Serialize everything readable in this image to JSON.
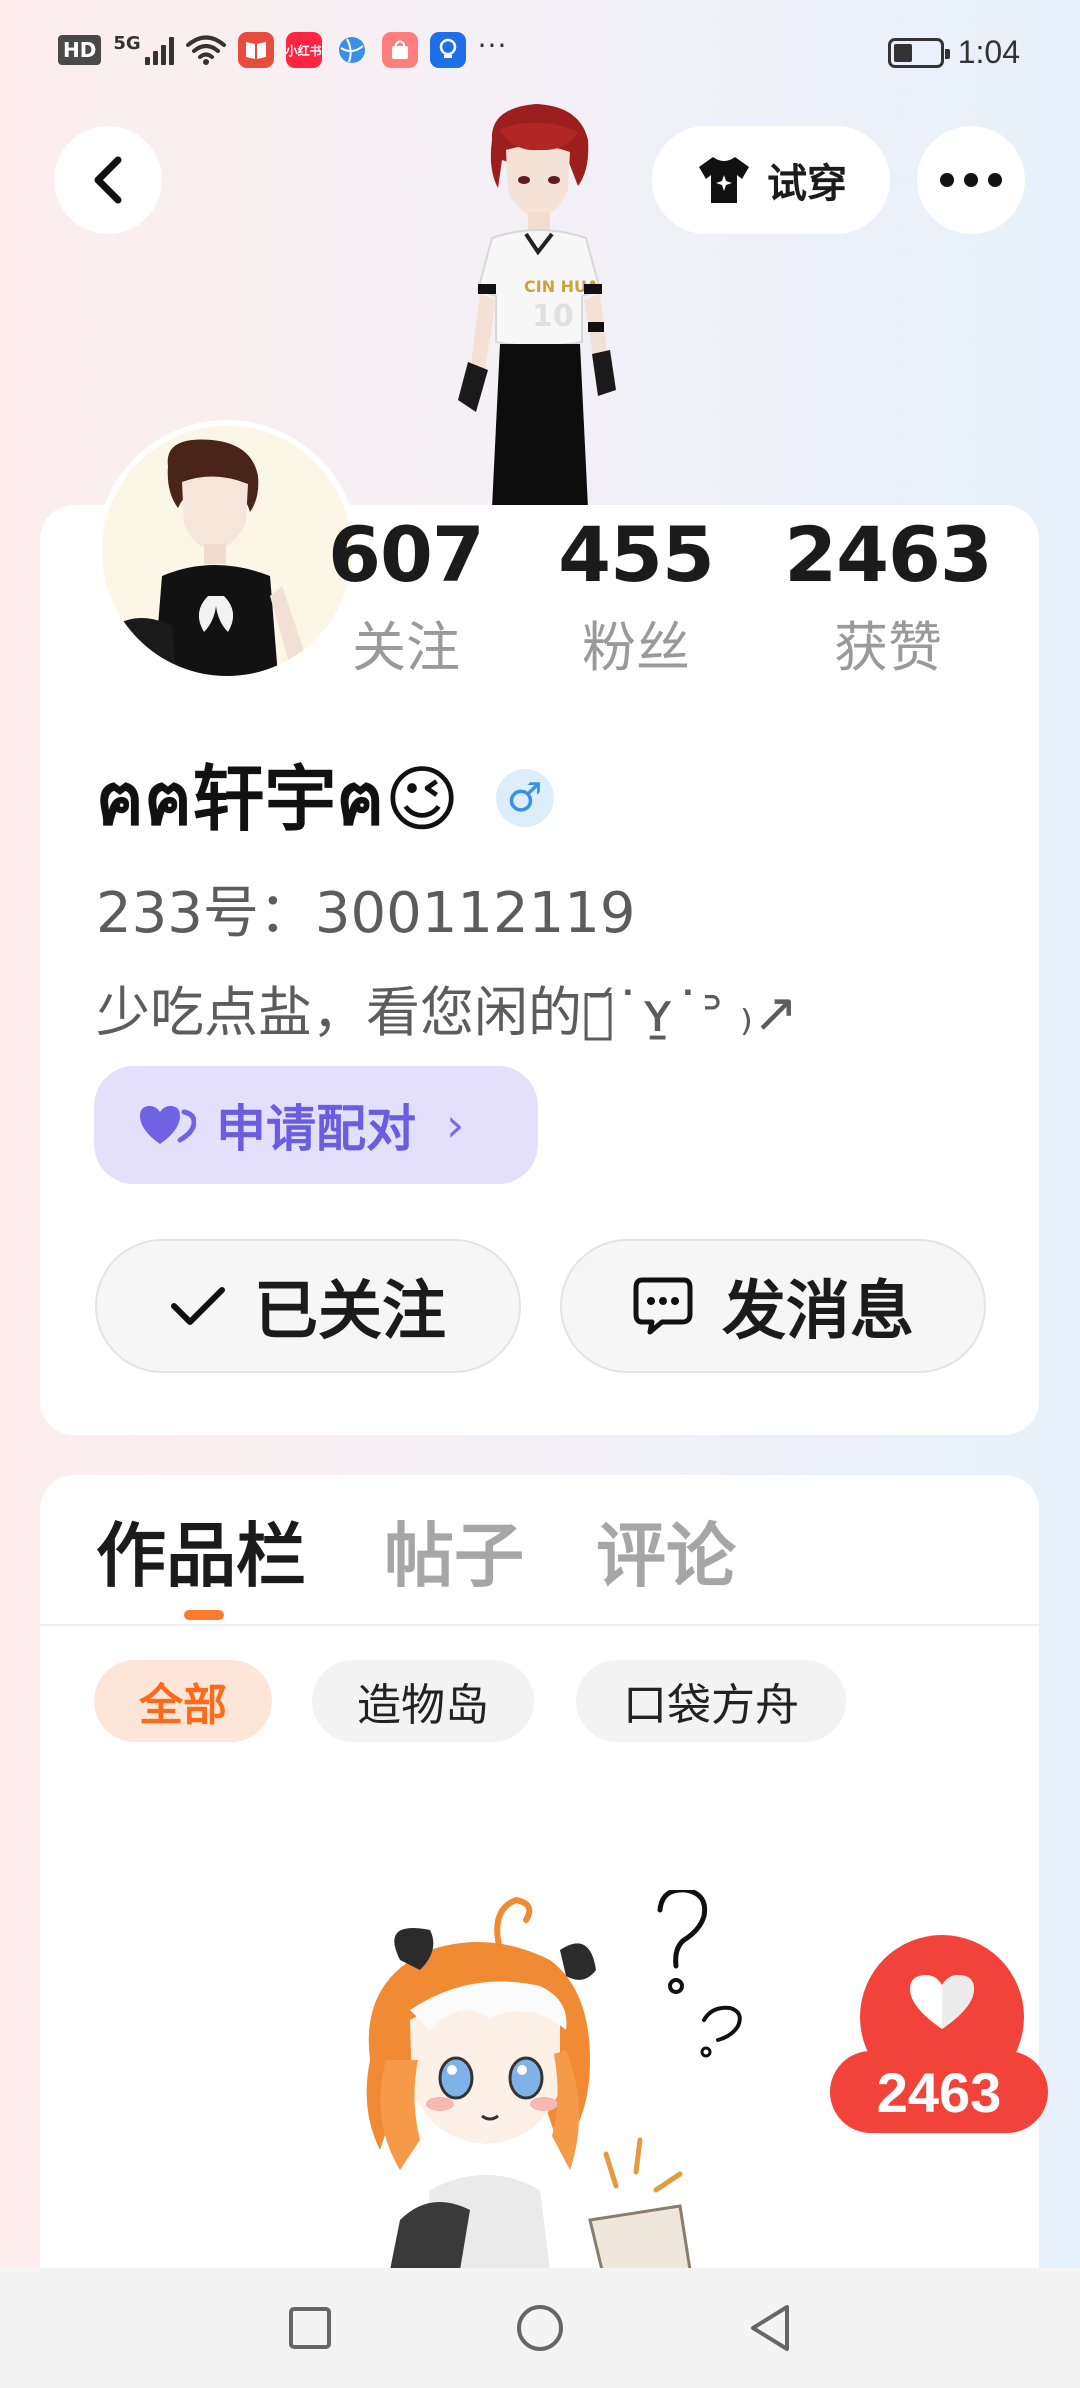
{
  "status_bar": {
    "hd_label": "HD",
    "network": "5G",
    "app_icons": [
      {
        "name": "red-book-icon",
        "color": "#e84c3d",
        "label": ""
      },
      {
        "name": "xiaohongshu-icon",
        "color": "#ff2442",
        "label": "小红书"
      },
      {
        "name": "globe-icon",
        "color": "#3a8fe6",
        "label": ""
      },
      {
        "name": "shopping-icon",
        "color": "#ff6b6b",
        "label": ""
      },
      {
        "name": "lightbulb-icon",
        "color": "#1e6fe8",
        "label": ""
      }
    ],
    "more": "···",
    "time": "1:04",
    "battery_level": 0.42
  },
  "header": {
    "tryon_label": "试穿"
  },
  "profile": {
    "stats": [
      {
        "value": "607",
        "label": "关注"
      },
      {
        "value": "455",
        "label": "粉丝"
      },
      {
        "value": "2463",
        "label": "获赞"
      }
    ],
    "username": "ฅฅ轩宇ฅ😉",
    "gender_symbol": "♂",
    "uid": "233号：300112119",
    "bio": "少吃点盐，看您闲的ꉂ᷄˙ʏ̱˙ᐣ ₎↗",
    "pair_button": "申请配对",
    "follow_button": "已关注",
    "message_button": "发消息"
  },
  "works": {
    "tabs": [
      {
        "label": "作品栏",
        "active": true
      },
      {
        "label": "帖子",
        "active": false
      },
      {
        "label": "评论",
        "active": false
      }
    ],
    "chips": [
      {
        "label": "全部",
        "active": true
      },
      {
        "label": "造物岛",
        "active": false
      },
      {
        "label": "口袋方舟",
        "active": false
      }
    ]
  },
  "like_float": {
    "count": "2463"
  },
  "colors": {
    "accent_orange": "#ff7b2c",
    "like_red": "#f2433b",
    "pair_purple": "#6b5ce0"
  }
}
